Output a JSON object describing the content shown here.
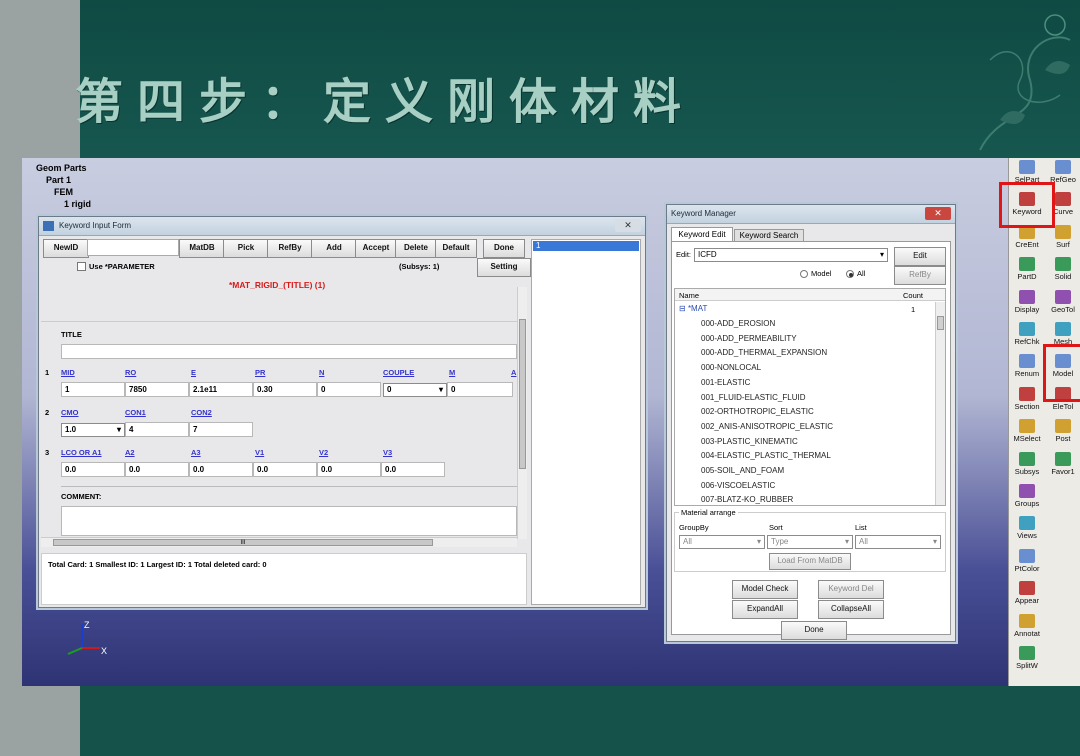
{
  "slide": {
    "title": "第四步：定义刚体材料"
  },
  "tree": {
    "items": [
      "Geom Parts",
      "Part 1",
      "FEM",
      "1 rigid"
    ]
  },
  "kif": {
    "title": "Keyword Input Form",
    "buttons": [
      "NewID",
      "MatDB",
      "Pick",
      "RefBy",
      "Add",
      "Accept",
      "Delete",
      "Default",
      "Done"
    ],
    "use_parameter": "Use *PARAMETER",
    "subsys": "(Subsys: 1)",
    "setting": "Setting",
    "keyword_title": "*MAT_RIGID_(TITLE)  (1)",
    "title_label": "TITLE",
    "row1": {
      "num": "1",
      "labels": [
        "MID",
        "RO",
        "E",
        "PR",
        "N",
        "COUPLE",
        "M",
        "A"
      ],
      "values": [
        "1",
        "7850",
        "2.1e11",
        "0.30",
        "0",
        "0",
        "0"
      ]
    },
    "row2": {
      "num": "2",
      "labels": [
        "CMO",
        "CON1",
        "CON2"
      ],
      "values": [
        "1.0",
        "4",
        "7"
      ]
    },
    "row3": {
      "num": "3",
      "labels": [
        "LCO OR A1",
        "A2",
        "A3",
        "V1",
        "V2",
        "V3"
      ],
      "values": [
        "0.0",
        "0.0",
        "0.0",
        "0.0",
        "0.0",
        "0.0"
      ]
    },
    "comment_label": "COMMENT:",
    "hscroll_mark": "III",
    "status": "Total Card: 1    Smallest ID: 1    Largest ID: 1    Total deleted card:  0",
    "id_list": [
      "1"
    ]
  },
  "km": {
    "title": "Keyword Manager",
    "tabs": [
      "Keyword Edit",
      "Keyword Search"
    ],
    "edit_label": "Edit:",
    "edit_value": "ICFD",
    "edit_btn": "Edit",
    "radio_model": "Model",
    "radio_all": "All",
    "refby_btn": "RefBy",
    "col_name": "Name",
    "col_count": "Count",
    "group": {
      "name": "*MAT",
      "count": "1"
    },
    "items": [
      "000-ADD_EROSION",
      "000-ADD_PERMEABILITY",
      "000-ADD_THERMAL_EXPANSION",
      "000-NONLOCAL",
      "001-ELASTIC",
      "001_FLUID-ELASTIC_FLUID",
      "002-ORTHOTROPIC_ELASTIC",
      "002_ANIS-ANISOTROPIC_ELASTIC",
      "003-PLASTIC_KINEMATIC",
      "004-ELASTIC_PLASTIC_THERMAL",
      "005-SOIL_AND_FOAM",
      "006-VISCOELASTIC",
      "007-BLATZ-KO_RUBBER"
    ],
    "arrange_label": "Material arrange",
    "groupby_label": "GroupBy",
    "sort_label": "Sort",
    "list_label": "List",
    "groupby_value": "All",
    "sort_value": "Type",
    "list_value": "All",
    "load_btn": "Load From MatDB",
    "model_check": "Model Check",
    "keyword_del": "Keyword Del",
    "expand_all": "ExpandAll",
    "collapse_all": "CollapseAll",
    "done": "Done"
  },
  "toolbar": {
    "col1": [
      "SelPart",
      "Keyword",
      "CreEnt",
      "PartD",
      "Display",
      "RefChk",
      "Renum",
      "Section",
      "MSelect",
      "Subsys",
      "Groups",
      "Views",
      "PtColor",
      "Appear",
      "Annotat",
      "SplitW"
    ],
    "col2": [
      "RefGeo",
      "Curve",
      "Surf",
      "Solid",
      "GeoTol",
      "Mesh",
      "Model",
      "EleTol",
      "Post",
      "Favor1"
    ]
  },
  "axis": {
    "z": "Z",
    "x": "X"
  },
  "colors": {
    "slide_bg": "#14524a",
    "title_text": "#a8cfc3",
    "link": "#3333cc",
    "keyword_red": "#e01616",
    "list_select": "#3a78d8"
  }
}
